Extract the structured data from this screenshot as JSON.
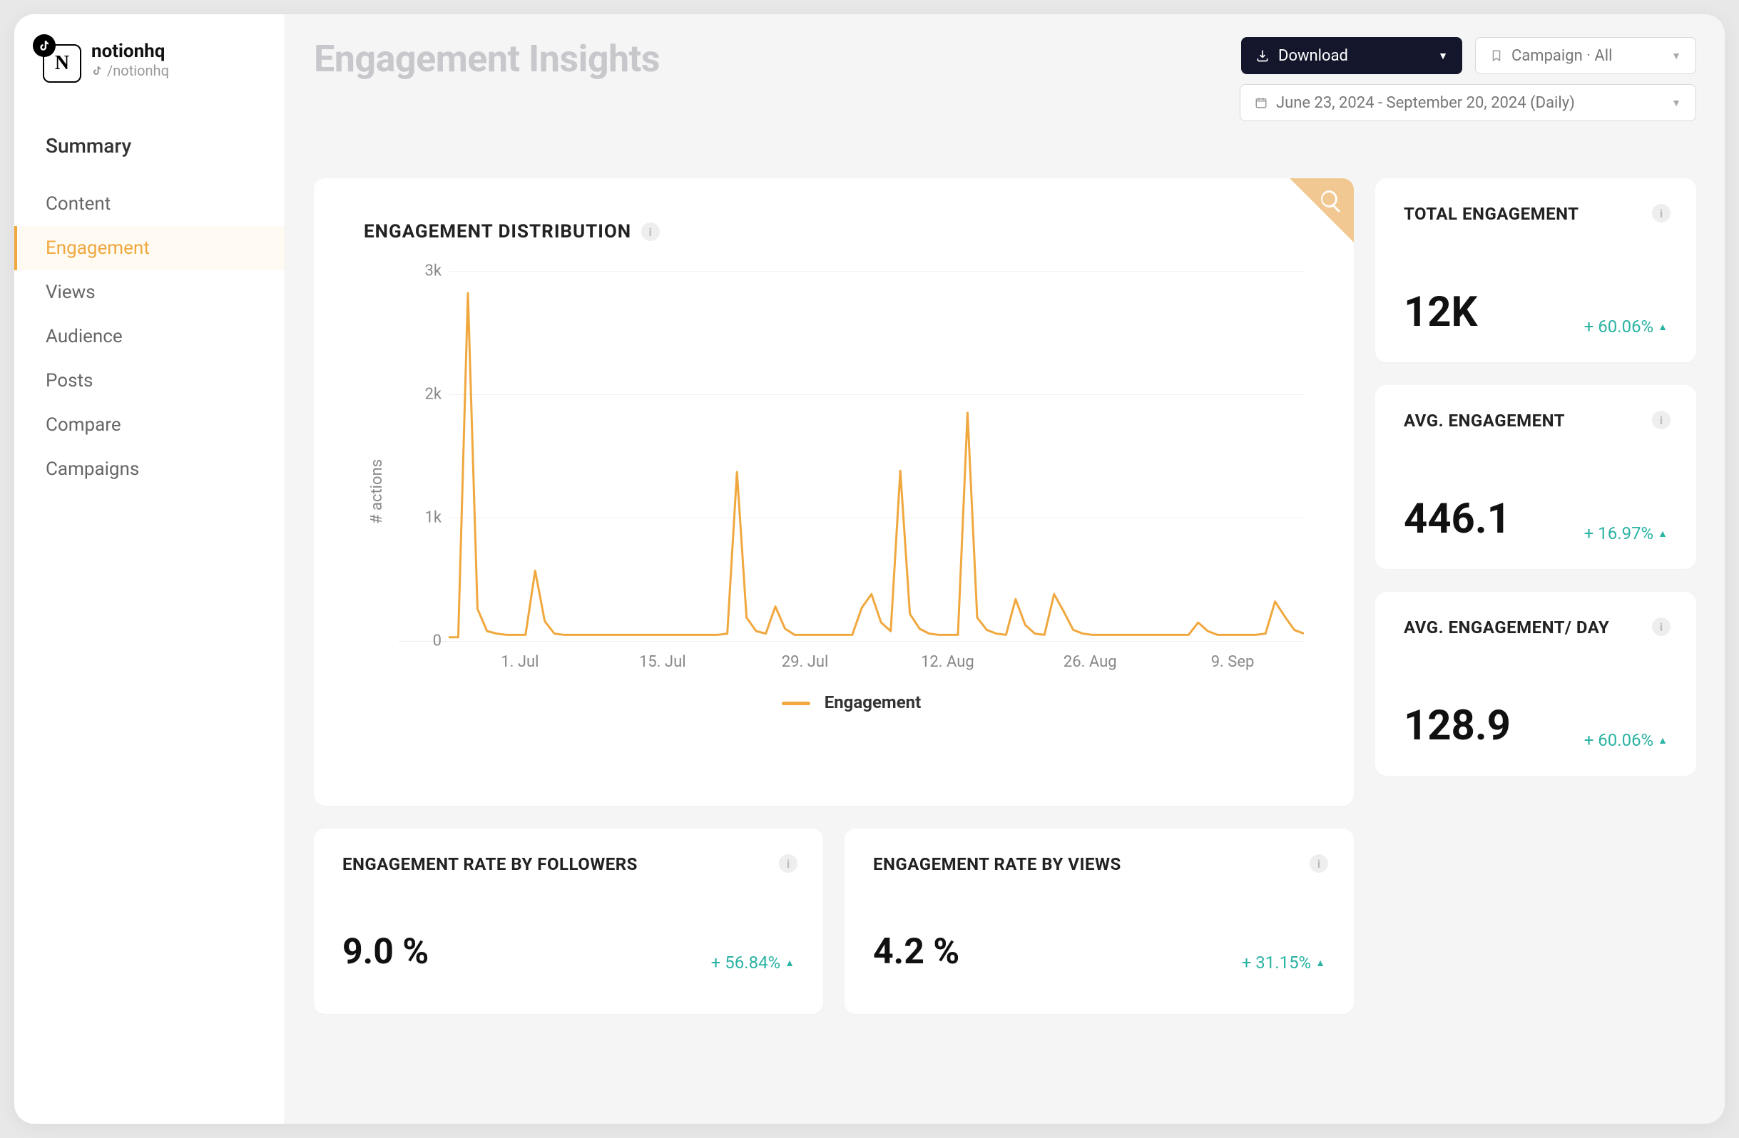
{
  "profile": {
    "name": "notionhq",
    "handle": "/notionhq",
    "logo_letter": "N"
  },
  "sidebar": {
    "items": [
      {
        "label": "Summary",
        "kind": "primary"
      },
      {
        "label": "Content",
        "kind": "normal"
      },
      {
        "label": "Engagement",
        "kind": "active"
      },
      {
        "label": "Views",
        "kind": "normal"
      },
      {
        "label": "Audience",
        "kind": "normal"
      },
      {
        "label": "Posts",
        "kind": "normal"
      },
      {
        "label": "Compare",
        "kind": "normal"
      },
      {
        "label": "Campaigns",
        "kind": "normal"
      }
    ]
  },
  "header": {
    "title": "Engagement Insights",
    "download_label": "Download",
    "campaign_label": "Campaign · All",
    "date_label": "June 23, 2024 - September 20, 2024 (Daily)"
  },
  "chart": {
    "title": "ENGAGEMENT DISTRIBUTION",
    "y_label": "# actions",
    "legend": "Engagement"
  },
  "metrics": {
    "right": [
      {
        "title": "TOTAL ENGAGEMENT",
        "value": "12K",
        "delta": "+ 60.06%"
      },
      {
        "title": "AVG. ENGAGEMENT",
        "value": "446.1",
        "delta": "+ 16.97%"
      },
      {
        "title": "AVG. ENGAGEMENT/ DAY",
        "value": "128.9",
        "delta": "+ 60.06%"
      }
    ],
    "bottom": [
      {
        "title": "ENGAGEMENT RATE BY FOLLOWERS",
        "value": "9.0 %",
        "delta": "+ 56.84%"
      },
      {
        "title": "ENGAGEMENT RATE BY VIEWS",
        "value": "4.2 %",
        "delta": "+ 31.15%"
      }
    ]
  },
  "chart_data": {
    "type": "line",
    "title": "ENGAGEMENT DISTRIBUTION",
    "xlabel": "",
    "ylabel": "# actions",
    "ylim": [
      0,
      3000
    ],
    "y_ticks": [
      "0",
      "1k",
      "2k",
      "3k"
    ],
    "x_ticks": [
      "1. Jul",
      "15. Jul",
      "29. Jul",
      "12. Aug",
      "26. Aug",
      "9. Sep"
    ],
    "series": [
      {
        "name": "Engagement",
        "color": "#f0a83e",
        "x": [
          0,
          1,
          2,
          3,
          4,
          5,
          6,
          7,
          8,
          9,
          10,
          11,
          12,
          13,
          14,
          15,
          16,
          17,
          18,
          19,
          20,
          21,
          22,
          23,
          24,
          25,
          26,
          27,
          28,
          29,
          30,
          31,
          32,
          33,
          34,
          35,
          36,
          37,
          38,
          39,
          40,
          41,
          42,
          43,
          44,
          45,
          46,
          47,
          48,
          49,
          50,
          51,
          52,
          53,
          54,
          55,
          56,
          57,
          58,
          59,
          60,
          61,
          62,
          63,
          64,
          65,
          66,
          67,
          68,
          69,
          70,
          71,
          72,
          73,
          74,
          75,
          76,
          77,
          78,
          79,
          80,
          81,
          82,
          83,
          84,
          85,
          86,
          87,
          88,
          89
        ],
        "values": [
          30,
          30,
          2820,
          260,
          80,
          60,
          50,
          50,
          50,
          570,
          160,
          60,
          50,
          50,
          50,
          50,
          50,
          50,
          50,
          50,
          50,
          50,
          50,
          50,
          50,
          50,
          50,
          50,
          50,
          60,
          1370,
          190,
          80,
          60,
          280,
          100,
          50,
          50,
          50,
          50,
          50,
          50,
          50,
          270,
          380,
          150,
          80,
          1380,
          220,
          100,
          60,
          50,
          50,
          50,
          1850,
          190,
          90,
          60,
          50,
          340,
          130,
          60,
          50,
          380,
          240,
          90,
          60,
          50,
          50,
          50,
          50,
          50,
          50,
          50,
          50,
          50,
          50,
          50,
          150,
          80,
          50,
          50,
          50,
          50,
          50,
          60,
          320,
          200,
          90,
          60
        ]
      }
    ]
  }
}
